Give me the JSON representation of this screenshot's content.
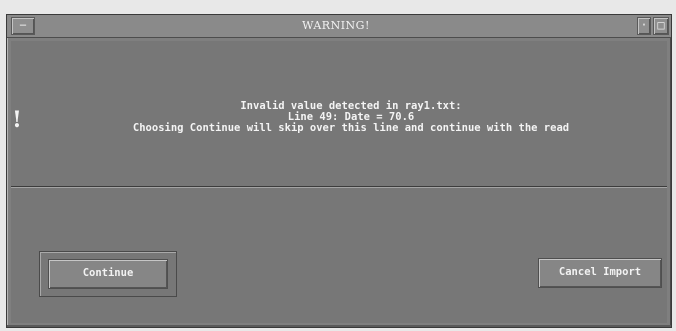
{
  "window": {
    "title": "WARNING!",
    "menu_glyph": "−",
    "minimize_glyph": "·",
    "maximize_glyph": "□"
  },
  "message": {
    "icon_glyph": "!",
    "line1": "Invalid value detected in ray1.txt:",
    "line2": "Line 49:  Date = 70.6",
    "line3": "Choosing Continue will skip over this line and continue with the read"
  },
  "buttons": {
    "continue_label": "Continue",
    "cancel_label": "Cancel Import"
  },
  "colors": {
    "dialog_background": "#777777",
    "titlebar": "#8a8a8a",
    "text": "#f4f4f4"
  }
}
